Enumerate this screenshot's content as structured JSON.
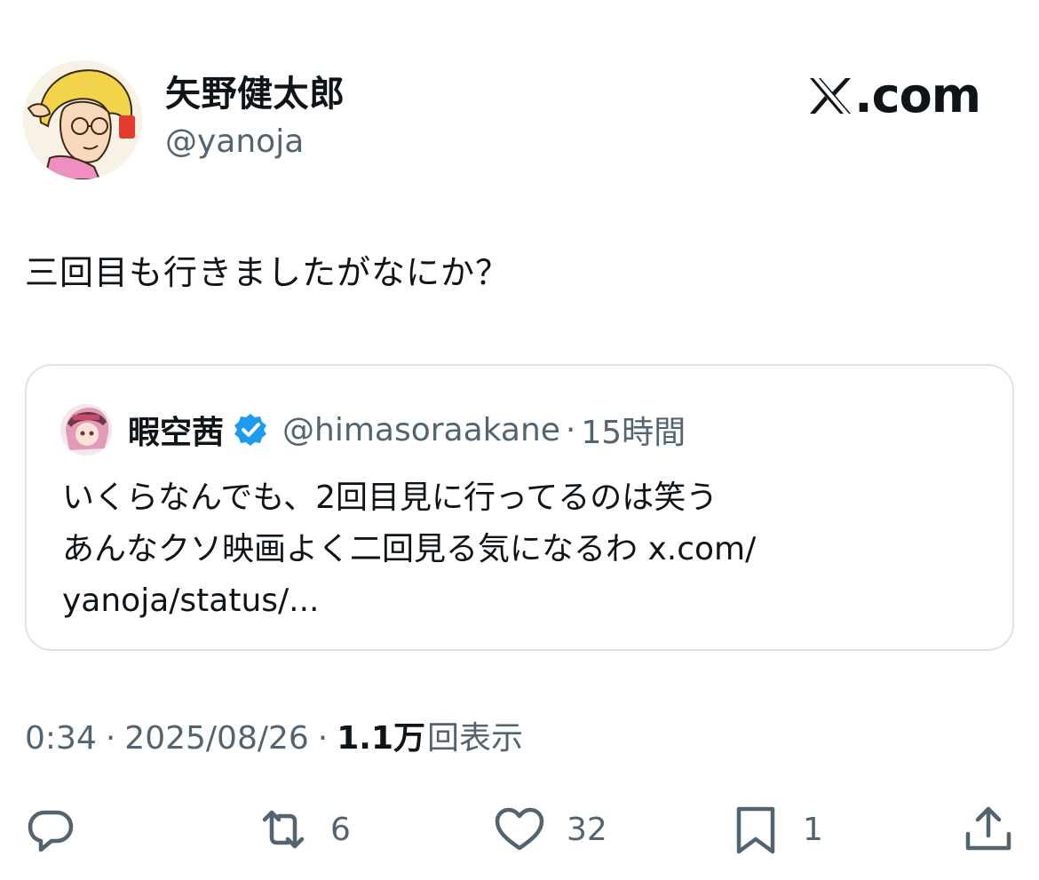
{
  "author": {
    "display_name": "矢野健太郎",
    "handle": "@yanoja"
  },
  "brand": {
    "label": ".com"
  },
  "tweet": {
    "text": "三回目も行きましたがなにか？"
  },
  "quote": {
    "display_name": "暇空茜",
    "handle": "@himasoraakane",
    "separator": "·",
    "time": "15時間",
    "lines": [
      "いくらなんでも、2回目見に行ってるのは笑う",
      "あんなクソ映画よく二回見る気になるわ x.com/",
      "yanoja/status/..."
    ]
  },
  "meta": {
    "time": "0:34",
    "separator": "·",
    "date": "2025/08/26",
    "views_count": "1.1万",
    "views_label": "回表示"
  },
  "actions": {
    "reply_count": "",
    "retweet_count": "6",
    "like_count": "32",
    "bookmark_count": "1"
  },
  "icons": {
    "brand": "x-logo-icon",
    "verified": "verified-badge-icon",
    "reply": "reply-icon",
    "retweet": "retweet-icon",
    "like": "heart-icon",
    "bookmark": "bookmark-icon",
    "share": "share-icon"
  },
  "colors": {
    "text": "#0f1419",
    "secondary": "#536471",
    "verified": "#1d9bf0",
    "border": "#dfe4e8"
  }
}
